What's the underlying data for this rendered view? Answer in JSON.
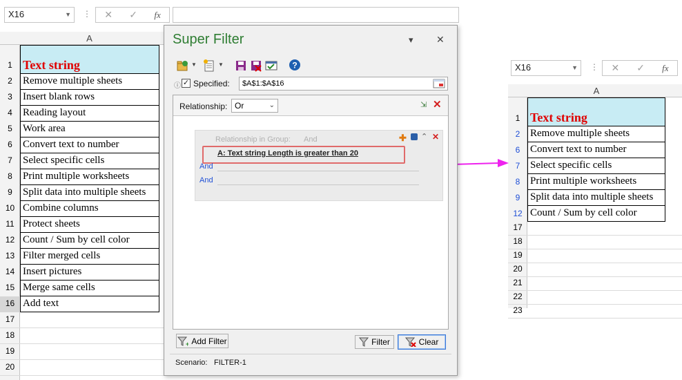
{
  "left_sheet": {
    "name_box": "X16",
    "fx_symbol": "fx",
    "column_header": "A",
    "rows": [
      {
        "num": "1",
        "text": "Text string"
      },
      {
        "num": "2",
        "text": "Remove multiple sheets"
      },
      {
        "num": "3",
        "text": "Insert blank rows"
      },
      {
        "num": "4",
        "text": "Reading layout"
      },
      {
        "num": "5",
        "text": "Work area"
      },
      {
        "num": "6",
        "text": "Convert text to number"
      },
      {
        "num": "7",
        "text": "Select specific cells"
      },
      {
        "num": "8",
        "text": "Print multiple worksheets"
      },
      {
        "num": "9",
        "text": "Split data into multiple sheets"
      },
      {
        "num": "10",
        "text": "Combine columns"
      },
      {
        "num": "11",
        "text": "Protect sheets"
      },
      {
        "num": "12",
        "text": "Count / Sum by cell color"
      },
      {
        "num": "13",
        "text": "Filter merged cells"
      },
      {
        "num": "14",
        "text": "Insert pictures"
      },
      {
        "num": "15",
        "text": "Merge same cells"
      },
      {
        "num": "16",
        "text": "Add text"
      },
      {
        "num": "17",
        "text": ""
      },
      {
        "num": "18",
        "text": ""
      },
      {
        "num": "19",
        "text": ""
      },
      {
        "num": "20",
        "text": ""
      }
    ]
  },
  "dialog": {
    "title": "Super Filter",
    "minimize_glyph": "▾",
    "close_glyph": "✕",
    "specified_label": "Specified:",
    "specified_checked": true,
    "range_value": "$A$1:$A$16",
    "relationship_label": "Relationship:",
    "relationship_value": "Or",
    "group_relationship_label": "Relationship in Group:",
    "group_relationship_value": "And",
    "condition": "A: Text string  Length is greater than  20",
    "and_labels": [
      "And",
      "And"
    ],
    "add_filter_label": "Add Filter",
    "filter_label": "Filter",
    "clear_label": "Clear",
    "scenario_label": "Scenario:",
    "scenario_value": "FILTER-1"
  },
  "right_sheet": {
    "name_box": "X16",
    "fx_symbol": "fx",
    "column_header": "A",
    "rows": [
      {
        "num": "1",
        "text": "Text string"
      },
      {
        "num": "2",
        "text": "Remove multiple sheets"
      },
      {
        "num": "6",
        "text": "Convert text to number"
      },
      {
        "num": "7",
        "text": "Select specific cells"
      },
      {
        "num": "8",
        "text": "Print multiple worksheets"
      },
      {
        "num": "9",
        "text": "Split data into multiple sheets"
      },
      {
        "num": "12",
        "text": "Count / Sum by cell color"
      },
      {
        "num": "17",
        "text": ""
      },
      {
        "num": "18",
        "text": ""
      },
      {
        "num": "19",
        "text": ""
      },
      {
        "num": "20",
        "text": ""
      },
      {
        "num": "21",
        "text": ""
      },
      {
        "num": "22",
        "text": ""
      },
      {
        "num": "23",
        "text": ""
      }
    ]
  },
  "colors": {
    "header_fill": "#c8ecf4",
    "header_text": "#e00000",
    "filtered_row_number": "#1f4fd6",
    "arrow": "#ee22ee",
    "title_green": "#2e7d32"
  }
}
